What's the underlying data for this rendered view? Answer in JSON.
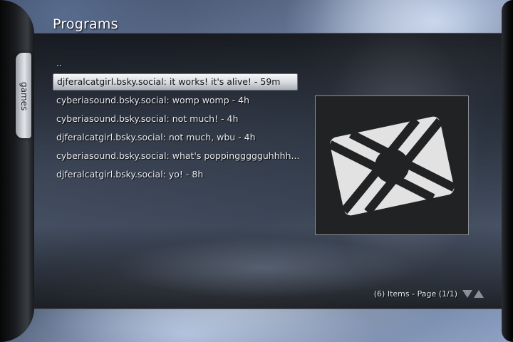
{
  "header": {
    "title": "Programs"
  },
  "sidebar": {
    "tab_label": "games"
  },
  "list": {
    "items": [
      {
        "label": ".."
      },
      {
        "label": "djferalcatgirl.bsky.social: it works! it's alive! - 59m",
        "selected": true
      },
      {
        "label": "cyberiasound.bsky.social: womp womp - 4h"
      },
      {
        "label": "cyberiasound.bsky.social: not much! - 4h"
      },
      {
        "label": "djferalcatgirl.bsky.social: not much, wbu - 4h"
      },
      {
        "label": "cyberiasound.bsky.social: what's poppinggggguhhhh..."
      },
      {
        "label": "djferalcatgirl.bsky.social: yo! - 8h"
      }
    ]
  },
  "thumbnail": {
    "icon": "envelope-x-icon",
    "background": "#212224",
    "foreground": "#e2e2e2"
  },
  "footer": {
    "page_info": "(6) Items - Page (1/1)"
  },
  "colors": {
    "selection": "#d9dce2",
    "text": "#e8eaee",
    "arrow": "#8b9098"
  }
}
